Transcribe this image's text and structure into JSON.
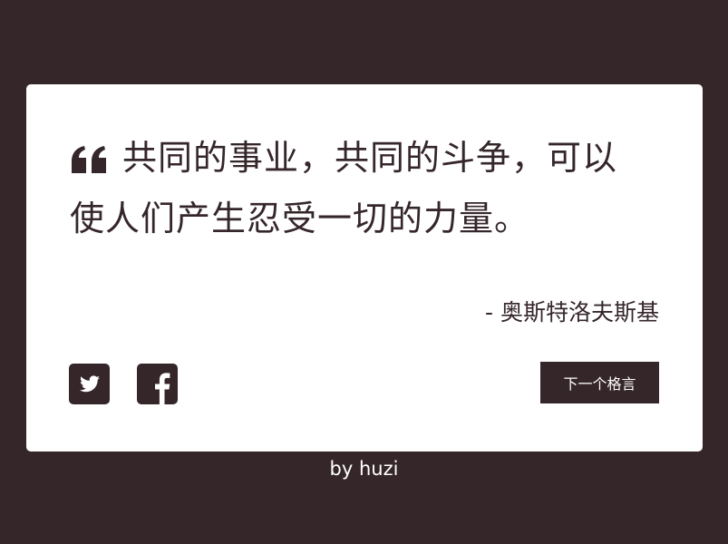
{
  "quote": {
    "icon": "quote-left-icon",
    "text": "共同的事业，共同的斗争，可以使人们产生忍受一切的力量。",
    "author": "- 奥斯特洛夫斯基"
  },
  "social": {
    "twitter_icon": "twitter-icon",
    "facebook_icon": "facebook-icon"
  },
  "actions": {
    "next_label": "下一个格言"
  },
  "footer": {
    "credit": "by huzi"
  },
  "colors": {
    "background": "#35262a",
    "card": "#ffffff",
    "text": "#35262a",
    "button_text": "#ffffff"
  }
}
